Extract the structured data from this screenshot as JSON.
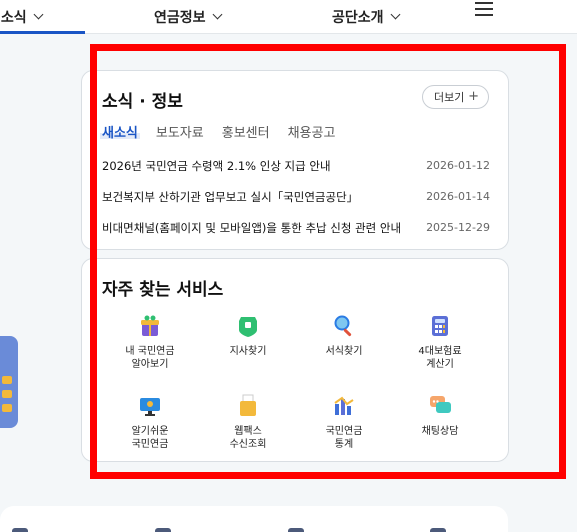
{
  "nav": {
    "items": [
      {
        "label": "새소식"
      },
      {
        "label": "연금정보"
      },
      {
        "label": "공단소개"
      }
    ]
  },
  "news": {
    "title": "소식 · 정보",
    "more_label": "더보기",
    "more_plus": "+",
    "tabs": [
      "새소식",
      "보도자료",
      "홍보센터",
      "채용공고"
    ],
    "active_tab": "새소식",
    "items": [
      {
        "title": "2026년 국민연금 수령액 2.1% 인상 지급 안내",
        "date": "2026-01-12"
      },
      {
        "title": "보건복지부 산하기관 업무보고 실시「국민연금공단」",
        "date": "2026-01-14"
      },
      {
        "title": "비대면채널(홈페이지 및 모바일앱)을 통한 추납 신청 관련 안내",
        "date": "2025-12-29"
      }
    ]
  },
  "services": {
    "title": "자주 찾는 서비스",
    "items": [
      {
        "label": "내 국민연금\n알아보기",
        "icon": "gift-box-icon",
        "color": "#7b5cd6"
      },
      {
        "label": "지사찾기",
        "icon": "map-pin-icon",
        "color": "#2fbf71"
      },
      {
        "label": "서식찾기",
        "icon": "magnifier-icon",
        "color": "#2a7be4"
      },
      {
        "label": "4대보험료\n계산기",
        "icon": "calculator-icon",
        "color": "#5b6fd6"
      },
      {
        "label": "알기쉬운\n국민연금",
        "icon": "monitor-icon",
        "color": "#2a8be0"
      },
      {
        "label": "웹팩스\n수신조회",
        "icon": "folder-icon",
        "color": "#f3b93b"
      },
      {
        "label": "국민연금\n통계",
        "icon": "bar-chart-icon",
        "color": "#3f6fd8"
      },
      {
        "label": "채팅상담",
        "icon": "chat-bubble-icon",
        "color": "#f6a66b"
      }
    ]
  },
  "colors": {
    "accent": "#1a55c5",
    "highlight": "#ff0000"
  }
}
